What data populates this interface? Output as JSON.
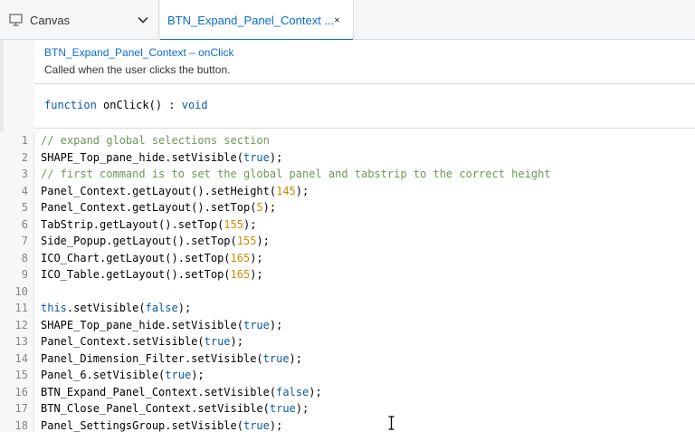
{
  "tabs": {
    "canvas": {
      "label": "Canvas",
      "icon": "monitor-icon"
    },
    "active": {
      "label": "BTN_Expand_Panel_Context ...",
      "close_icon": "close-icon"
    }
  },
  "doc": {
    "title": "BTN_Expand_Panel_Context – onClick",
    "description": "Called when the user clicks the button.",
    "signature": {
      "keyword": "function",
      "name": " onClick() : ",
      "return_type": "void"
    }
  },
  "code": {
    "lines": [
      {
        "n": "1",
        "tokens": [
          {
            "t": "// expand global selections section",
            "k": "comment"
          }
        ]
      },
      {
        "n": "2",
        "tokens": [
          {
            "t": "SHAPE_Top_pane_hide.setVisible(",
            "k": "plain"
          },
          {
            "t": "true",
            "k": "bool"
          },
          {
            "t": ");",
            "k": "plain"
          }
        ]
      },
      {
        "n": "3",
        "tokens": [
          {
            "t": "// first command is to set the global panel and tabstrip to the correct height",
            "k": "comment"
          }
        ]
      },
      {
        "n": "4",
        "tokens": [
          {
            "t": "Panel_Context.getLayout().setHeight(",
            "k": "plain"
          },
          {
            "t": "145",
            "k": "number"
          },
          {
            "t": ");",
            "k": "plain"
          }
        ]
      },
      {
        "n": "5",
        "tokens": [
          {
            "t": "Panel_Context.getLayout().setTop(",
            "k": "plain"
          },
          {
            "t": "5",
            "k": "number"
          },
          {
            "t": ");",
            "k": "plain"
          }
        ]
      },
      {
        "n": "6",
        "tokens": [
          {
            "t": "TabStrip.getLayout().setTop(",
            "k": "plain"
          },
          {
            "t": "155",
            "k": "number"
          },
          {
            "t": ");",
            "k": "plain"
          }
        ]
      },
      {
        "n": "7",
        "tokens": [
          {
            "t": "Side_Popup.getLayout().setTop(",
            "k": "plain"
          },
          {
            "t": "155",
            "k": "number"
          },
          {
            "t": ");",
            "k": "plain"
          }
        ]
      },
      {
        "n": "8",
        "tokens": [
          {
            "t": "ICO_Chart.getLayout().setTop(",
            "k": "plain"
          },
          {
            "t": "165",
            "k": "number"
          },
          {
            "t": ");",
            "k": "plain"
          }
        ]
      },
      {
        "n": "9",
        "tokens": [
          {
            "t": "ICO_Table.getLayout().setTop(",
            "k": "plain"
          },
          {
            "t": "165",
            "k": "number"
          },
          {
            "t": ");",
            "k": "plain"
          }
        ]
      },
      {
        "n": "10",
        "tokens": []
      },
      {
        "n": "11",
        "tokens": [
          {
            "t": "this",
            "k": "kw"
          },
          {
            "t": ".setVisible(",
            "k": "plain"
          },
          {
            "t": "false",
            "k": "bool"
          },
          {
            "t": ");",
            "k": "plain"
          }
        ]
      },
      {
        "n": "12",
        "tokens": [
          {
            "t": "SHAPE_Top_pane_hide.setVisible(",
            "k": "plain"
          },
          {
            "t": "true",
            "k": "bool"
          },
          {
            "t": ");",
            "k": "plain"
          }
        ]
      },
      {
        "n": "13",
        "tokens": [
          {
            "t": "Panel_Context.setVisible(",
            "k": "plain"
          },
          {
            "t": "true",
            "k": "bool"
          },
          {
            "t": ");",
            "k": "plain"
          }
        ]
      },
      {
        "n": "14",
        "tokens": [
          {
            "t": "Panel_Dimension_Filter.setVisible(",
            "k": "plain"
          },
          {
            "t": "true",
            "k": "bool"
          },
          {
            "t": ");",
            "k": "plain"
          }
        ]
      },
      {
        "n": "15",
        "tokens": [
          {
            "t": "Panel_6.setVisible(",
            "k": "plain"
          },
          {
            "t": "true",
            "k": "bool"
          },
          {
            "t": ");",
            "k": "plain"
          }
        ]
      },
      {
        "n": "16",
        "tokens": [
          {
            "t": "BTN_Expand_Panel_Context.setVisible(",
            "k": "plain"
          },
          {
            "t": "false",
            "k": "bool"
          },
          {
            "t": ");",
            "k": "plain"
          }
        ]
      },
      {
        "n": "17",
        "tokens": [
          {
            "t": "BTN_Close_Panel_Context.setVisible(",
            "k": "plain"
          },
          {
            "t": "true",
            "k": "bool"
          },
          {
            "t": ");",
            "k": "plain"
          }
        ]
      },
      {
        "n": "18",
        "tokens": [
          {
            "t": "Panel_SettingsGroup.setVisible(",
            "k": "plain"
          },
          {
            "t": "true",
            "k": "bool"
          },
          {
            "t": ");",
            "k": "plain"
          }
        ]
      }
    ]
  },
  "icons": {
    "chevron": "chevron-down-icon",
    "cursor": "text-cursor-icon",
    "grip": "resize-grip-icon"
  }
}
